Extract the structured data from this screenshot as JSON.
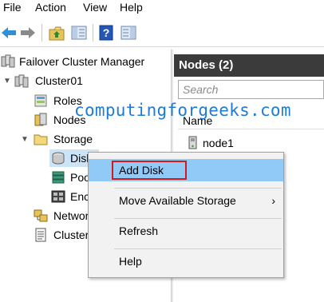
{
  "menubar": {
    "items": [
      "File",
      "Action",
      "View",
      "Help"
    ]
  },
  "toolbar": {
    "buttons": [
      "back-icon",
      "forward-icon",
      "up-folder-icon",
      "show-hide-console-tree-icon",
      "help-icon",
      "action-pane-icon"
    ]
  },
  "tree": {
    "root": "Failover Cluster Manager",
    "cluster": "Cluster01",
    "roles": "Roles",
    "nodes": "Nodes",
    "storage": "Storage",
    "disks": "Disk",
    "pools": "Poo",
    "enclosures": "Enc",
    "networks": "Networ",
    "cluster_events": "Cluster"
  },
  "pane": {
    "title": "Nodes (2)",
    "search_placeholder": "Search",
    "column_name": "Name",
    "node1": "node1"
  },
  "watermark": "computingforgeeks.com",
  "context_menu": {
    "add_disk": "Add Disk",
    "move_available_storage": "Move Available Storage",
    "submenu_arrow": "›",
    "refresh": "Refresh",
    "help": "Help"
  },
  "colors": {
    "menu_hover": "#91c9f7",
    "highlight_border": "#d11a1a",
    "watermark": "#1e7bd6",
    "pane_header": "#3b3b3b"
  }
}
